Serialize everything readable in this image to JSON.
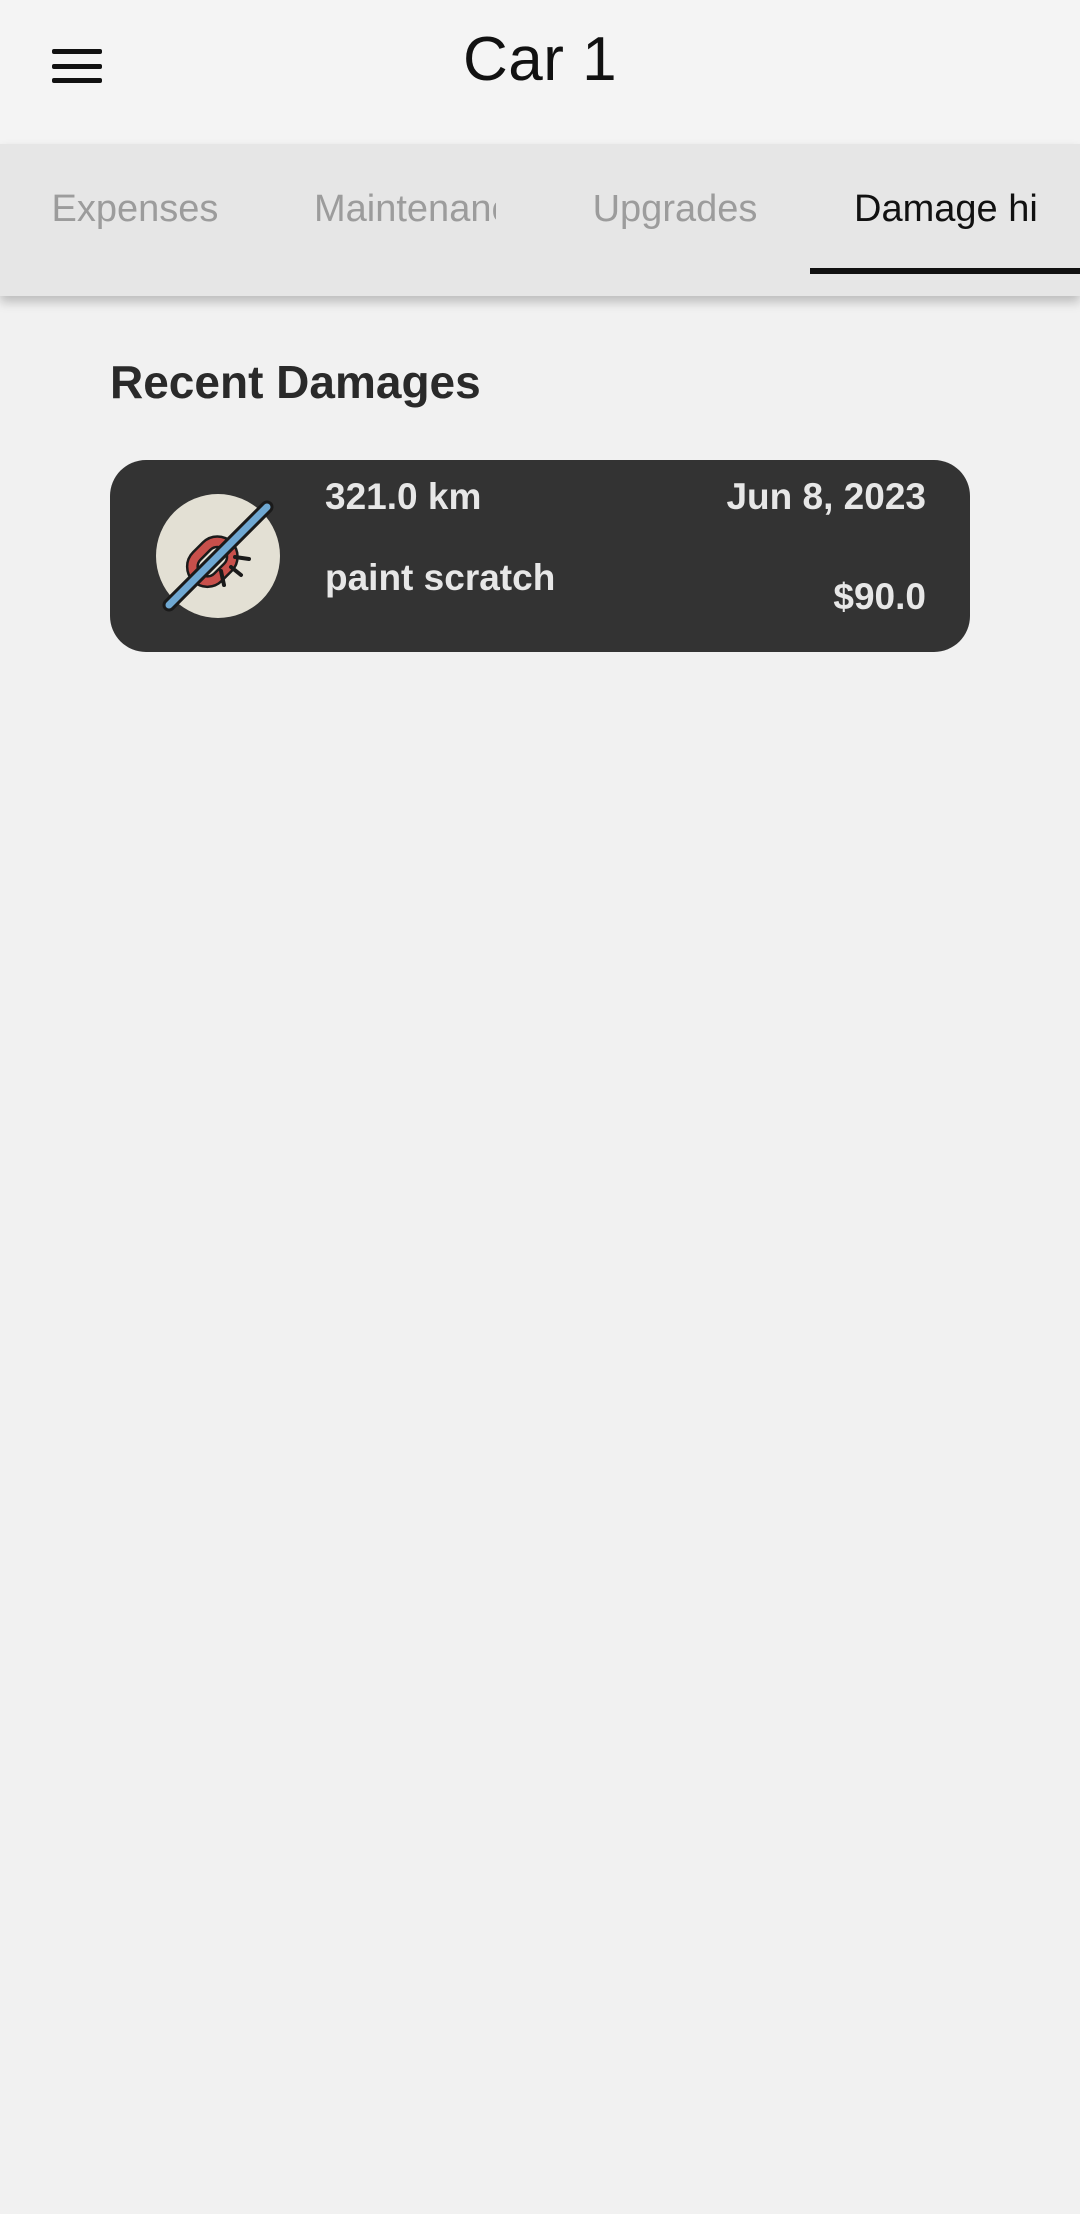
{
  "app_bar": {
    "title": "Car 1",
    "menu_icon": "hamburger-menu-icon"
  },
  "tabs": [
    {
      "label": "Expenses",
      "selected": false
    },
    {
      "label": "Maintenance",
      "selected": false
    },
    {
      "label": "Upgrades",
      "selected": false
    },
    {
      "label": "Damage history",
      "selected": true
    }
  ],
  "main": {
    "section_title": "Recent Damages",
    "damages": [
      {
        "icon": "broken-link-icon",
        "odometer": "321.0 km",
        "date": "Jun 8, 2023",
        "description": "paint scratch",
        "cost": "$90.0"
      }
    ]
  },
  "colors": {
    "background": "#f1f1f1",
    "tab_bar": "#e6e6e6",
    "card": "#333333",
    "card_text": "#e7e7e7",
    "selected_tab": "#111111",
    "unselected_tab": "#9c9c9c"
  }
}
